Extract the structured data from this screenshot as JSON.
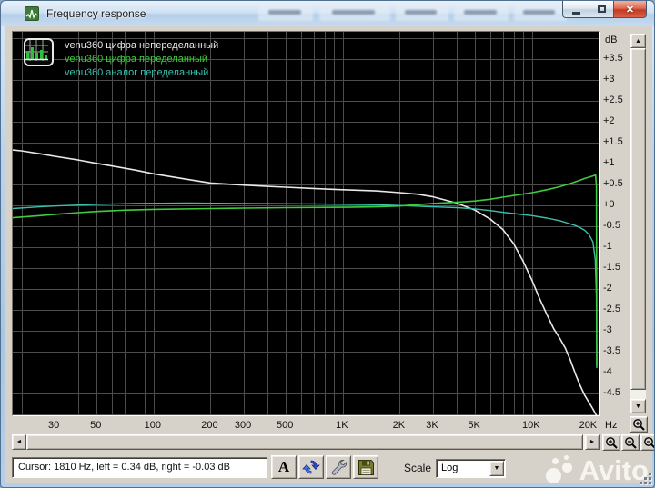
{
  "window": {
    "title": "Frequency response"
  },
  "window_controls": {
    "minimize": "minimize",
    "maximize": "maximize",
    "close": "close"
  },
  "axes": {
    "y_unit": "dB",
    "x_unit": "Hz"
  },
  "statusbar": {
    "cursor_text": "Cursor:  1810 Hz,  left = 0.34 dB,  right = -0.03 dB"
  },
  "toolbar": {
    "font_button_label": "A",
    "scale_label": "Scale",
    "scale_value": "Log"
  },
  "watermark": {
    "text": "Avito"
  },
  "colors": {
    "plot_bg": "#000000",
    "grid": "#4c4c4c",
    "white_curve": "#e9e9e9",
    "green_curve": "#3ecc3e",
    "cyan_curve": "#3cc0ae"
  },
  "chart_data": {
    "type": "line",
    "title": "Frequency response",
    "xlabel": "Hz",
    "ylabel": "dB",
    "x_scale": "log",
    "xlim": [
      18,
      22500
    ],
    "ylim": [
      -5.03,
      4.15
    ],
    "grid": {
      "x_lines": [
        20,
        30,
        40,
        50,
        60,
        70,
        80,
        90,
        100,
        200,
        300,
        400,
        500,
        600,
        700,
        800,
        900,
        1000,
        2000,
        3000,
        4000,
        5000,
        6000,
        7000,
        8000,
        9000,
        10000,
        20000
      ],
      "y_lines": [
        4,
        3.5,
        3,
        2.5,
        2,
        1.5,
        1,
        0.5,
        0,
        -0.5,
        -1,
        -1.5,
        -2,
        -2.5,
        -3,
        -3.5,
        -4,
        -4.5,
        -5
      ]
    },
    "x_ticks": [
      {
        "f": 30,
        "label": "30"
      },
      {
        "f": 50,
        "label": "50"
      },
      {
        "f": 100,
        "label": "100"
      },
      {
        "f": 200,
        "label": "200"
      },
      {
        "f": 300,
        "label": "300"
      },
      {
        "f": 500,
        "label": "500"
      },
      {
        "f": 1000,
        "label": "1K"
      },
      {
        "f": 2000,
        "label": "2K"
      },
      {
        "f": 3000,
        "label": "3K"
      },
      {
        "f": 5000,
        "label": "5K"
      },
      {
        "f": 10000,
        "label": "10K"
      },
      {
        "f": 20000,
        "label": "20K"
      }
    ],
    "y_ticks": [
      {
        "v": 3.5,
        "label": "+3.5"
      },
      {
        "v": 3,
        "label": "+3"
      },
      {
        "v": 2.5,
        "label": "+2.5"
      },
      {
        "v": 2,
        "label": "+2"
      },
      {
        "v": 1.5,
        "label": "+1.5"
      },
      {
        "v": 1,
        "label": "+1"
      },
      {
        "v": 0.5,
        "label": "+0.5"
      },
      {
        "v": 0,
        "label": "+0"
      },
      {
        "v": -0.5,
        "label": "-0.5"
      },
      {
        "v": -1,
        "label": "-1"
      },
      {
        "v": -1.5,
        "label": "-1.5"
      },
      {
        "v": -2,
        "label": "-2"
      },
      {
        "v": -2.5,
        "label": "-2.5"
      },
      {
        "v": -3,
        "label": "-3"
      },
      {
        "v": -3.5,
        "label": "-3.5"
      },
      {
        "v": -4,
        "label": "-4"
      },
      {
        "v": -4.5,
        "label": "-4.5"
      }
    ],
    "legend_position": "top-left",
    "series": [
      {
        "name": "venu360 цифра непеределанный",
        "color": "#e9e9e9",
        "width": 1.6,
        "points": [
          [
            18,
            1.32
          ],
          [
            20,
            1.3
          ],
          [
            25,
            1.23
          ],
          [
            30,
            1.17
          ],
          [
            40,
            1.08
          ],
          [
            50,
            1.0
          ],
          [
            60,
            0.94
          ],
          [
            80,
            0.84
          ],
          [
            100,
            0.75
          ],
          [
            150,
            0.62
          ],
          [
            200,
            0.53
          ],
          [
            300,
            0.48
          ],
          [
            400,
            0.45
          ],
          [
            500,
            0.43
          ],
          [
            700,
            0.4
          ],
          [
            1000,
            0.37
          ],
          [
            1500,
            0.34
          ],
          [
            2000,
            0.3
          ],
          [
            2500,
            0.26
          ],
          [
            3000,
            0.2
          ],
          [
            4000,
            0.05
          ],
          [
            5000,
            -0.12
          ],
          [
            6000,
            -0.33
          ],
          [
            7000,
            -0.58
          ],
          [
            8000,
            -0.92
          ],
          [
            9000,
            -1.35
          ],
          [
            10000,
            -1.8
          ],
          [
            11000,
            -2.25
          ],
          [
            12000,
            -2.62
          ],
          [
            13000,
            -2.95
          ],
          [
            14000,
            -3.18
          ],
          [
            15000,
            -3.42
          ],
          [
            16000,
            -3.72
          ],
          [
            17000,
            -4.05
          ],
          [
            18000,
            -4.32
          ],
          [
            19000,
            -4.55
          ],
          [
            20000,
            -4.72
          ],
          [
            21000,
            -4.88
          ],
          [
            22000,
            -5.05
          ]
        ]
      },
      {
        "name": "venu360 аналог переделанный",
        "color": "#3cc0ae",
        "width": 1.4,
        "points": [
          [
            18,
            -0.08
          ],
          [
            25,
            -0.04
          ],
          [
            30,
            -0.02
          ],
          [
            50,
            0.02
          ],
          [
            80,
            0.04
          ],
          [
            150,
            0.05
          ],
          [
            300,
            0.04
          ],
          [
            700,
            0.03
          ],
          [
            1500,
            0.01
          ],
          [
            2000,
            -0.01
          ],
          [
            3000,
            -0.04
          ],
          [
            4000,
            -0.06
          ],
          [
            5000,
            -0.09
          ],
          [
            6000,
            -0.13
          ],
          [
            7000,
            -0.17
          ],
          [
            8000,
            -0.2
          ],
          [
            10000,
            -0.25
          ],
          [
            12000,
            -0.31
          ],
          [
            14000,
            -0.37
          ],
          [
            16000,
            -0.45
          ],
          [
            17000,
            -0.49
          ],
          [
            18000,
            -0.54
          ],
          [
            19000,
            -0.6
          ],
          [
            20000,
            -0.7
          ],
          [
            21000,
            -0.88
          ],
          [
            21600,
            -1.3
          ],
          [
            21900,
            -2.2
          ],
          [
            22000,
            -3.9
          ]
        ]
      },
      {
        "name": "venu360 цифра переделанный",
        "color": "#3ecc3e",
        "width": 1.6,
        "points": [
          [
            18,
            -0.3
          ],
          [
            25,
            -0.25
          ],
          [
            30,
            -0.22
          ],
          [
            40,
            -0.18
          ],
          [
            50,
            -0.15
          ],
          [
            70,
            -0.12
          ],
          [
            100,
            -0.1
          ],
          [
            200,
            -0.08
          ],
          [
            300,
            -0.07
          ],
          [
            500,
            -0.06
          ],
          [
            1000,
            -0.05
          ],
          [
            1500,
            -0.04
          ],
          [
            2000,
            -0.02
          ],
          [
            3000,
            0.04
          ],
          [
            4000,
            0.07
          ],
          [
            5000,
            0.1
          ],
          [
            6000,
            0.14
          ],
          [
            7000,
            0.19
          ],
          [
            8000,
            0.23
          ],
          [
            10000,
            0.3
          ],
          [
            12000,
            0.37
          ],
          [
            14000,
            0.44
          ],
          [
            16000,
            0.52
          ],
          [
            17000,
            0.56
          ],
          [
            18000,
            0.6
          ],
          [
            19000,
            0.64
          ],
          [
            20000,
            0.67
          ],
          [
            21000,
            0.7
          ],
          [
            21700,
            0.72
          ],
          [
            21900,
            0.45
          ],
          [
            22000,
            -3.85
          ]
        ]
      }
    ],
    "legend_order": [
      0,
      2,
      1
    ]
  }
}
